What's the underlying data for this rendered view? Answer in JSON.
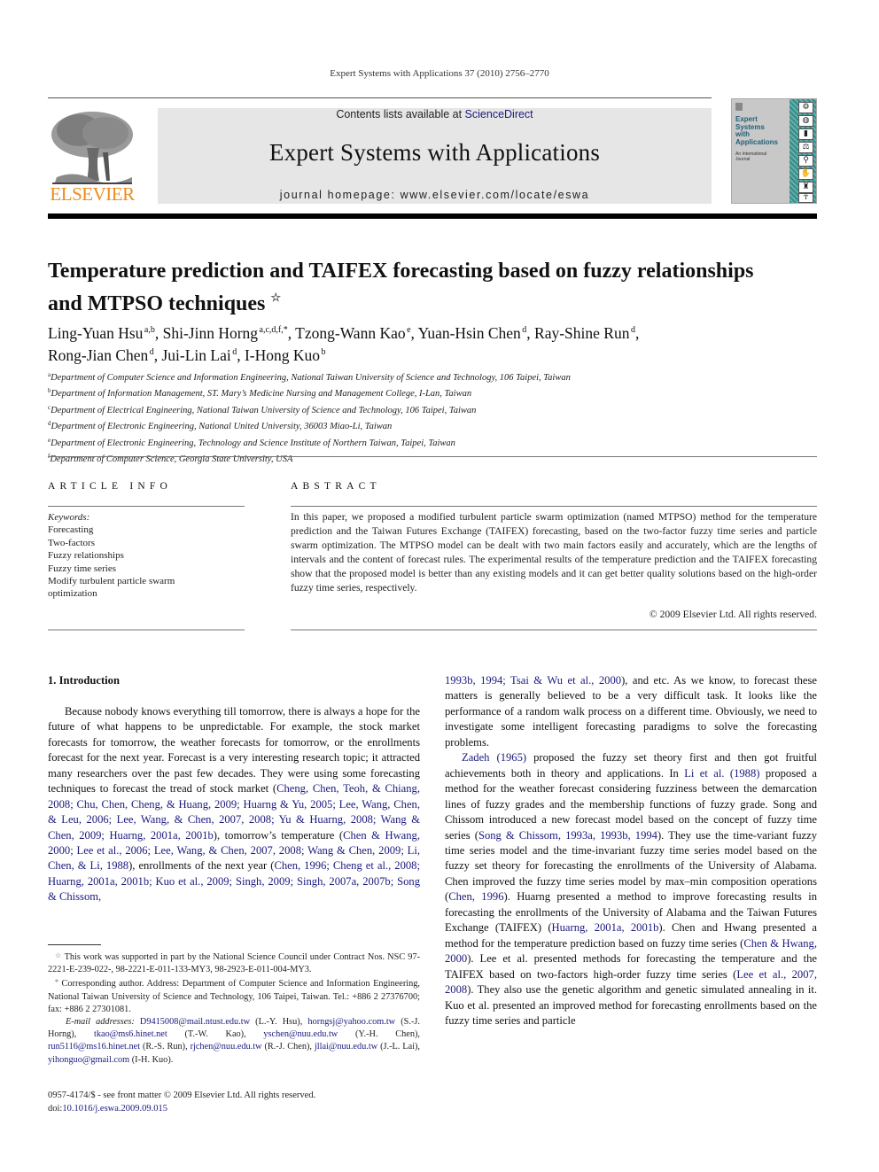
{
  "header": {
    "citation": "Expert Systems with Applications 37 (2010) 2756–2770",
    "contents_prefix": "Contents lists available at ",
    "contents_link": "ScienceDirect",
    "journal_title": "Expert Systems with Applications",
    "homepage": "journal homepage: www.elsevier.com/locate/eswa",
    "publisher_logo": "ELSEVIER",
    "cover": {
      "title_lines": [
        "Expert",
        "Systems",
        "with",
        "Applications"
      ],
      "subtitle_lines": [
        "An International",
        "Journal"
      ],
      "icons": [
        "gear-icon",
        "globe-icon",
        "bar-chart-icon",
        "scales-icon",
        "microscope-icon",
        "handshake-icon",
        "tower-icon",
        "figure-icon"
      ]
    },
    "colors": {
      "elsevier_orange": "#f08a1c",
      "link_blue": "#1a1a7e",
      "banner_gray": "#e6e6e6",
      "cover_teal": "#3a8a86"
    }
  },
  "article": {
    "title_line1": "Temperature prediction and TAIFEX forecasting based on fuzzy relationships",
    "title_line2": "and MTPSO techniques",
    "title_mark": "☆",
    "authors": [
      {
        "name": "Ling-Yuan Hsu",
        "aff": "a,b",
        "sep": ", "
      },
      {
        "name": "Shi-Jinn Horng",
        "aff": "a,c,d,f,*",
        "sep": ", "
      },
      {
        "name": "Tzong-Wann Kao",
        "aff": "e",
        "sep": ", "
      },
      {
        "name": "Yuan-Hsin Chen",
        "aff": "d",
        "sep": ", "
      },
      {
        "name": "Ray-Shine Run",
        "aff": "d",
        "sep": ","
      },
      {
        "name": "Rong-Jian Chen",
        "aff": "d",
        "sep": ", "
      },
      {
        "name": "Jui-Lin Lai",
        "aff": "d",
        "sep": ", "
      },
      {
        "name": "I-Hong Kuo",
        "aff": "b",
        "sep": ""
      }
    ],
    "affiliations": [
      {
        "key": "a",
        "text": "Department of Computer Science and Information Engineering, National Taiwan University of Science and Technology, 106 Taipei, Taiwan"
      },
      {
        "key": "b",
        "text": "Department of Information Management, ST. Mary’s Medicine Nursing and Management College, I-Lan, Taiwan"
      },
      {
        "key": "c",
        "text": "Department of Electrical Engineering, National Taiwan University of Science and Technology, 106 Taipei, Taiwan"
      },
      {
        "key": "d",
        "text": "Department of Electronic Engineering, National United University, 36003 Miao-Li, Taiwan"
      },
      {
        "key": "e",
        "text": "Department of Electronic Engineering, Technology and Science Institute of Northern Taiwan, Taipei, Taiwan"
      },
      {
        "key": "f",
        "text": "Department of Computer Science, Georgia State University, USA"
      }
    ]
  },
  "article_info": {
    "heading": "ARTICLE INFO",
    "keywords_label": "Keywords:",
    "keywords": [
      "Forecasting",
      "Two-factors",
      "Fuzzy relationships",
      "Fuzzy time series",
      "Modify turbulent particle swarm",
      "optimization"
    ]
  },
  "abstract": {
    "heading": "ABSTRACT",
    "text": "In this paper, we proposed a modified turbulent particle swarm optimization (named MTPSO) method for the temperature prediction and the Taiwan Futures Exchange (TAIFEX) forecasting, based on the two-fac­tor fuzzy time series and particle swarm optimization. The MTPSO model can be dealt with two main fac­tors easily and accurately, which are the lengths of intervals and the content of forecast rules. The experimental results of the temperature prediction and the TAIFEX forecasting show that the proposed model is better than any existing models and it can get better quality solutions based on the high-order fuzzy time series, respectively.",
    "copyright": "© 2009 Elsevier Ltd. All rights reserved."
  },
  "body": {
    "section_heading": "1. Introduction",
    "left_p1": "Because nobody knows everything till tomorrow, there is al­ways a hope for the future of what happens to be unpredictable. For example, the stock market forecasts for tomorrow, the weather forecasts for tomorrow, or the enrollments forecast for the next year. Forecast is a very interesting research topic; it attracted many researchers over the past few decades. They were using some fore­casting techniques to forecast the tread of stock market (",
    "left_cite1": "Cheng, Chen, Teoh, & Chiang, 2008; Chu, Chen, Cheng, & Huang, 2009; Huarng & Yu, 2005; Lee, Wang, Chen, & Leu, 2006; Lee, Wang, & Chen, 2007, 2008; Yu & Huarng, 2008; Wang & Chen, 2009; Hua­rng, 2001a, 2001b",
    "left_mid1": "), tomorrow’s temperature (",
    "left_cite2": "Chen & Hwang, 2000; Lee et al., 2006; Lee, Wang, & Chen, 2007, 2008; Wang & Chen, 2009; Li, Chen, & Li, 1988",
    "left_mid2": "), enrollments of the next year (",
    "left_cite3": "Chen, 1996; Cheng et al., 2008; Huarng, 2001a, 2001b; Kuo et al., 2009; Singh, 2009; Singh, 2007a, 2007b; Song & Chissom,",
    "right_cite0": "1993b, 1994; Tsai & Wu et al., 2000",
    "right_p1_rest": "), and etc. As we know, to fore­cast these matters is generally believed to be a very difficult task. It looks like the performance of a random walk process on a different time. Obviously, we need to investigate some intelligent forecast­ing paradigms to solve the forecasting problems.",
    "right_cite_zadeh": "Zadeh (1965)",
    "right_p2_a": " proposed the fuzzy set theory first and then got fruitful achievements both in theory and applications. In ",
    "right_cite_li": "Li et al. (1988)",
    "right_p2_b": " proposed a method for the weather forecast considering fuzziness between the demarcation lines of fuzzy grades and the membership functions of fuzzy grade. Song and Chissom intro­duced a new forecast model based on the concept of fuzzy time series (",
    "right_cite_song": "Song & Chissom, 1993a, 1993b, 1994",
    "right_p2_c": "). They use the time-variant fuzzy time series model and the time-invariant fuzzy time series model based on the fuzzy set theory for forecasting the enrollments of the University of Alabama. Chen improved the fuzzy time series model by max–min composition operations (",
    "right_cite_chen96": "Chen, 1996",
    "right_p2_d": "). Huarng presented a method to improve forecasting results in forecasting the enrollments of the University of Alabama and the Taiwan Futures Exchange (TAIFEX) (",
    "right_cite_huarng": "Huarng, 2001a, 2001b",
    "right_p2_e": "). Chen and Hwang presented a method for the temperature predic­tion based on fuzzy time series (",
    "right_cite_ch": "Chen & Hwang, 2000",
    "right_p2_f": "). Lee et al. presented methods for forecasting the temperature and the TAIFEX based on two-factors high-order fuzzy time series (",
    "right_cite_lee": "Lee et al., 2007, 2008",
    "right_p2_g": "). They also use the genetic algorithm and genetic simulated annealing in it. Kuo et al. presented an improved method for forecasting enrollments based on the fuzzy time series and particle"
  },
  "footnotes": {
    "star_mark": "☆",
    "funding": "This work was supported in part by the National Science Council under Contract Nos. NSC 97-2221-E-239-022-, 98-2221-E-011-133-MY3, 98-2923-E-011-004-MY3.",
    "corr_mark": "*",
    "corresponding": "Corresponding author. Address: Department of Computer Science and Infor­mation Engineering, National Taiwan University of Science and Technology, 106 Taipei, Taiwan. Tel.: +886 2 27376700; fax: +886 2 27301081.",
    "email_label": "E-mail addresses:",
    "emails": [
      {
        "addr": "D9415008@mail.ntust.edu.tw",
        "who": " (L.-Y. Hsu), "
      },
      {
        "addr": "horngsj@yahoo.com.tw",
        "who": " (S.-J. Horng), "
      },
      {
        "addr": "tkao@ms6.hinet.net",
        "who": " (T.-W. Kao), "
      },
      {
        "addr": "yschen@nuu.edu.tw",
        "who": " (Y.-H. Chen), "
      },
      {
        "addr": "run5116@ms16.hinet.net",
        "who": " (R.-S. Run), "
      },
      {
        "addr": "rjchen@nuu.edu.tw",
        "who": " (R.-J. Chen), "
      },
      {
        "addr": "jllai@nuu.edu.tw",
        "who": " (J.-L. Lai), "
      },
      {
        "addr": "yihonguo@gmail.com",
        "who": " (I-H. Kuo)."
      }
    ]
  },
  "front_matter": {
    "issn_line": "0957-4174/$ - see front matter © 2009 Elsevier Ltd. All rights reserved.",
    "doi_prefix": "doi:",
    "doi": "10.1016/j.eswa.2009.09.015"
  }
}
